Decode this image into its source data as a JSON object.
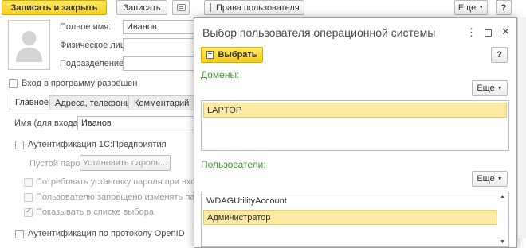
{
  "toolbar": {
    "save_close": "Записать и закрыть",
    "save": "Записать",
    "rights": "Права пользователя",
    "more": "Еще",
    "help": "?"
  },
  "form": {
    "full_name_label": "Полное имя:",
    "full_name_value": "Иванов",
    "person_label": "Физическое лицо:",
    "department_label": "Подразделение:",
    "login_allowed": "Вход в программу разрешен",
    "tabs": [
      "Главное",
      "Адреса, телефоны",
      "Комментарий"
    ],
    "login_name_label": "Имя (для входа):",
    "login_name_value": "Иванов",
    "auth_1c": "Аутентификация 1С:Предприятия",
    "empty_password": "Пустой пароль",
    "set_password": "Установить пароль...",
    "require_password": "Потребовать установку пароля при входе",
    "forbid_change": "Пользователю запрещено изменять пароль",
    "show_in_list": "Показывать в списке выбора",
    "openid": "Аутентификация по протоколу OpenID"
  },
  "dialog": {
    "title": "Выбор пользователя операционной системы",
    "select": "Выбрать",
    "help": "?",
    "domains_title": "Домены:",
    "domains_more": "Еще",
    "domains": [
      "LAPTOP"
    ],
    "users_title": "Пользователи:",
    "users_more": "Еще",
    "users": [
      "WDAGUtilityAccount",
      "Администратор"
    ]
  },
  "colors": {
    "accent_yellow": "#f4cf19",
    "section_green": "#3f9a2b",
    "selection": "#fbe9a4"
  }
}
